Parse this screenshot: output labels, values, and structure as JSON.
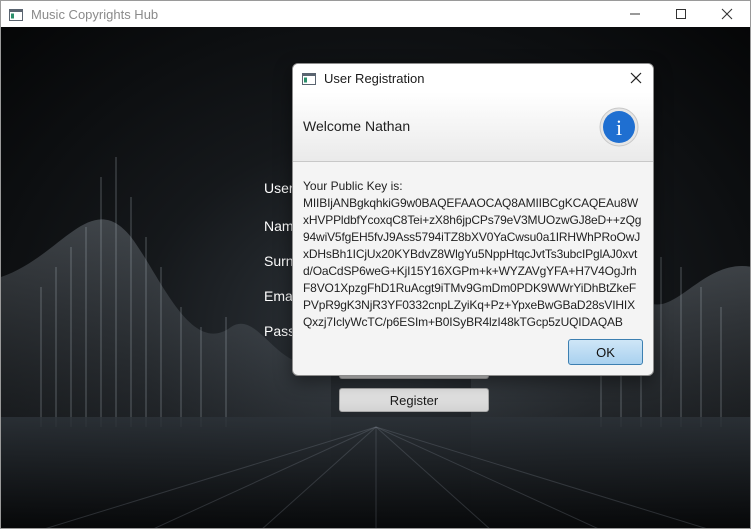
{
  "window": {
    "title": "Music Copyrights Hub",
    "icon": "app-window-icon"
  },
  "form": {
    "labels": [
      "User",
      "Nam",
      "Surn",
      "Emai",
      "Pass"
    ],
    "register_label": "Register"
  },
  "dialog": {
    "title": "User Registration",
    "header_text": "Welcome Nathan",
    "info_icon_glyph": "i",
    "key_label": "Your Public Key is:",
    "public_key": "MIIBIjANBgkqhkiG9w0BAQEFAAOCAQ8AMIIBCgKCAQEAu8WxHVPPldbfYcoxqC8Tei+zX8h6jpCPs79eV3MUOzwGJ8eD++zQg94wiV5fgEH5fvJ9Ass5794iTZ8bXV0YaCwsu0a1IRHWhPRoOwJxDHsBh1ICjUx20KYBdvZ8WlgYu5NppHtqcJvtTs3ubcIPglAJ0xvtd/OaCdSP6weG+KjI15Y16XGPm+k+WYZAVgYFA+H7V4OgJrhF8VO1XpzgFhD1RuAcgt9iTMv9GmDm0PDK9WWrYiDhBtZkeFPVpR9gK3NjR3YF0332cnpLZyiKq+Pz+YpxeBwGBaD28sVIHIXQxzj7IclyWcTC/p6ESIm+B0ISyBR4lzI48kTGcp5zUQIDAQAB",
    "ok_label": "OK"
  },
  "colors": {
    "accent": "#1f6fd1",
    "ok_border": "#3c7fb1"
  }
}
